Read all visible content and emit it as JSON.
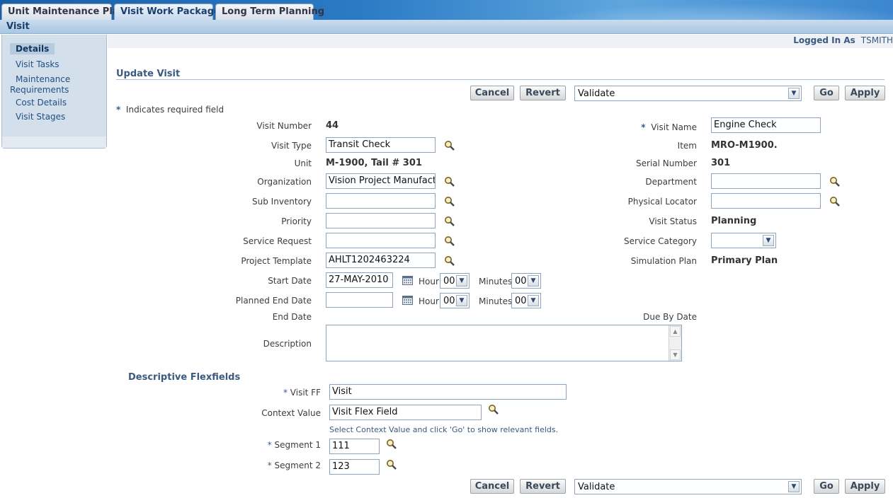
{
  "tabs": [
    {
      "label": "Unit Maintenance Plan"
    },
    {
      "label": "Visit Work Package"
    },
    {
      "label": "Long Term Planning"
    }
  ],
  "subheader": "Visit",
  "sidenav": {
    "items": [
      "Details",
      "Visit Tasks",
      "Maintenance",
      "Requirements",
      "Cost Details",
      "Visit Stages"
    ]
  },
  "user": {
    "logged_label": "Logged In As",
    "name": "TSMITH"
  },
  "section_title": "Update Visit",
  "actions": {
    "cancel": "Cancel",
    "revert": "Revert",
    "action_select": "Validate",
    "go": "Go",
    "apply": "Apply"
  },
  "required_note": "Indicates required field",
  "required_star": "*",
  "left_fields": {
    "visit_number": {
      "label": "Visit Number",
      "value": "44"
    },
    "visit_type": {
      "label": "Visit Type",
      "value": "Transit Check"
    },
    "unit": {
      "label": "Unit",
      "value": "M-1900, Tail # 301"
    },
    "organization": {
      "label": "Organization",
      "value": "Vision Project Manufacturing"
    },
    "sub_inventory": {
      "label": "Sub Inventory",
      "value": ""
    },
    "priority": {
      "label": "Priority",
      "value": ""
    },
    "service_request": {
      "label": "Service Request",
      "value": ""
    },
    "project_template": {
      "label": "Project Template",
      "value": "AHLT1202463224"
    },
    "start_date": {
      "label": "Start Date",
      "value": "27-MAY-2010"
    },
    "planned_end_date": {
      "label": "Planned End Date",
      "value": ""
    },
    "end_date": {
      "label": "End Date"
    },
    "description": {
      "label": "Description",
      "value": ""
    }
  },
  "time": {
    "hour_label": "Hour",
    "minutes_label": "Minutes",
    "start_hour": "00",
    "start_minutes": "00",
    "end_hour": "00",
    "end_minutes": "00"
  },
  "right_fields": {
    "visit_name": {
      "label": "Visit Name",
      "value": "Engine Check"
    },
    "item": {
      "label": "Item",
      "value": "MRO-M1900."
    },
    "serial_number": {
      "label": "Serial Number",
      "value": "301"
    },
    "department": {
      "label": "Department",
      "value": ""
    },
    "physical_locator": {
      "label": "Physical Locator",
      "value": ""
    },
    "visit_status": {
      "label": "Visit Status",
      "value": "Planning"
    },
    "service_category": {
      "label": "Service Category",
      "value": ""
    },
    "simulation_plan": {
      "label": "Simulation Plan",
      "value": "Primary Plan"
    },
    "due_by_date": {
      "label": "Due By Date"
    }
  },
  "flex": {
    "title": "Descriptive Flexfields",
    "visit_ff": {
      "label": "Visit FF",
      "value": "Visit"
    },
    "context_value": {
      "label": "Context Value",
      "value": "Visit Flex Field"
    },
    "hint": "Select Context Value and click 'Go' to show relevant fields.",
    "segment1": {
      "label": "Segment 1",
      "value": "111"
    },
    "segment2": {
      "label": "Segment 2",
      "value": "123"
    }
  },
  "colors": {
    "accent": "#3a5a80",
    "tabbar": "#2a7ac4",
    "nav": "#d3dfeb"
  },
  "icons": {
    "lookup": "magnifier-icon",
    "calendar": "calendar-icon",
    "dropdown": "chevron-down-icon"
  }
}
